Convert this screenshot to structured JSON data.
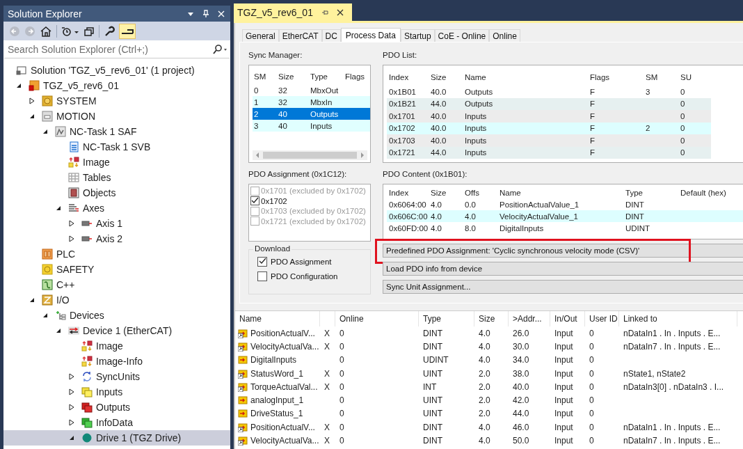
{
  "solution_explorer": {
    "title": "Solution Explorer",
    "search": {
      "placeholder": "Search Solution Explorer (Ctrl+;)"
    },
    "tree": [
      {
        "label": "Solution 'TGZ_v5_rev6_01' (1 project)",
        "kind": "solution",
        "selected": false,
        "children": [
          {
            "label": "TGZ_v5_rev6_01",
            "kind": "project",
            "expanded": true,
            "selected": false,
            "children": [
              {
                "label": "SYSTEM",
                "kind": "system",
                "expanded": false,
                "selected": false
              },
              {
                "label": "MOTION",
                "kind": "motion",
                "expanded": true,
                "selected": false,
                "children": [
                  {
                    "label": "NC-Task 1 SAF",
                    "kind": "nctask",
                    "expanded": true,
                    "selected": false,
                    "children": [
                      {
                        "label": "NC-Task 1 SVB",
                        "kind": "svb",
                        "selected": false
                      },
                      {
                        "label": "Image",
                        "kind": "image",
                        "selected": false
                      },
                      {
                        "label": "Tables",
                        "kind": "table",
                        "selected": false
                      },
                      {
                        "label": "Objects",
                        "kind": "objects",
                        "selected": false
                      },
                      {
                        "label": "Axes",
                        "kind": "axes",
                        "expanded": true,
                        "selected": false,
                        "children": [
                          {
                            "label": "Axis 1",
                            "kind": "axis",
                            "expanded": false,
                            "selected": false
                          },
                          {
                            "label": "Axis 2",
                            "kind": "axis",
                            "expanded": false,
                            "selected": false
                          }
                        ]
                      }
                    ]
                  }
                ]
              },
              {
                "label": "PLC",
                "kind": "plc",
                "selected": false
              },
              {
                "label": "SAFETY",
                "kind": "safety",
                "selected": false
              },
              {
                "label": "C++",
                "kind": "cpp",
                "selected": false
              },
              {
                "label": "I/O",
                "kind": "io",
                "expanded": true,
                "selected": false,
                "children": [
                  {
                    "label": "Devices",
                    "kind": "devices",
                    "expanded": true,
                    "selected": false,
                    "children": [
                      {
                        "label": "Device 1 (EtherCAT)",
                        "kind": "ethercat",
                        "expanded": true,
                        "selected": false,
                        "children": [
                          {
                            "label": "Image",
                            "kind": "image",
                            "selected": false
                          },
                          {
                            "label": "Image-Info",
                            "kind": "image",
                            "selected": false
                          },
                          {
                            "label": "SyncUnits",
                            "kind": "syncunits",
                            "expanded": false,
                            "selected": false
                          },
                          {
                            "label": "Inputs",
                            "kind": "inputs",
                            "expanded": false,
                            "selected": false
                          },
                          {
                            "label": "Outputs",
                            "kind": "outputs",
                            "expanded": false,
                            "selected": false
                          },
                          {
                            "label": "InfoData",
                            "kind": "infodata",
                            "expanded": false,
                            "selected": false
                          },
                          {
                            "label": "Drive 1 (TGZ Drive)",
                            "kind": "drive",
                            "expanded": true,
                            "selected": true
                          }
                        ]
                      }
                    ]
                  }
                ]
              }
            ]
          }
        ]
      }
    ]
  },
  "document_tab": {
    "title": "TGZ_v5_rev6_01"
  },
  "tabs": [
    {
      "label": "General",
      "selected": false
    },
    {
      "label": "EtherCAT",
      "selected": false
    },
    {
      "label": "DC",
      "selected": false
    },
    {
      "label": "Process Data",
      "selected": true
    },
    {
      "label": "Startup",
      "selected": false
    },
    {
      "label": "CoE - Online",
      "selected": false
    },
    {
      "label": "Online",
      "selected": false
    }
  ],
  "sync_manager": {
    "label": "Sync Manager:",
    "columns": [
      "SM",
      "Size",
      "Type",
      "Flags"
    ],
    "rows": [
      {
        "cells": [
          "0",
          "32",
          "MbxOut"
        ],
        "selected": false
      },
      {
        "cells": [
          "1",
          "32",
          "MbxIn"
        ],
        "selected": false
      },
      {
        "cells": [
          "2",
          "40",
          "Outputs"
        ],
        "selected": true
      },
      {
        "cells": [
          "3",
          "40",
          "Inputs"
        ],
        "selected": false
      }
    ]
  },
  "pdo_list": {
    "label": "PDO List:",
    "columns": [
      "Index",
      "Size",
      "Name",
      "Flags",
      "SM",
      "SU"
    ],
    "rows": [
      [
        "0x1B01",
        "40.0",
        "Outputs",
        "F",
        "3",
        "0"
      ],
      [
        "0x1B21",
        "44.0",
        "Outputs",
        "F",
        "",
        "0"
      ],
      [
        "0x1701",
        "40.0",
        "Inputs",
        "F",
        "",
        "0"
      ],
      [
        "0x1702",
        "40.0",
        "Inputs",
        "F",
        "2",
        "0"
      ],
      [
        "0x1703",
        "40.0",
        "Inputs",
        "F",
        "",
        "0"
      ],
      [
        "0x1721",
        "44.0",
        "Inputs",
        "F",
        "",
        "0"
      ]
    ]
  },
  "pdo_assignment": {
    "label": "PDO Assignment (0x1C12):",
    "items": [
      {
        "label": "0x1701 (excluded by 0x1702)",
        "checked": false,
        "disabled": true
      },
      {
        "label": "0x1702",
        "checked": true,
        "disabled": false
      },
      {
        "label": "0x1703 (excluded by 0x1702)",
        "checked": false,
        "disabled": true
      },
      {
        "label": "0x1721 (excluded by 0x1702)",
        "checked": false,
        "disabled": true
      }
    ]
  },
  "pdo_content": {
    "label": "PDO Content (0x1B01):",
    "columns": [
      "Index",
      "Size",
      "Offs",
      "Name",
      "Type",
      "Default (hex)"
    ],
    "rows": [
      [
        "0x6064:00",
        "4.0",
        "0.0",
        "PositionActualValue_1",
        "DINT",
        ""
      ],
      [
        "0x606C:00",
        "4.0",
        "4.0",
        "VelocityActualValue_1",
        "DINT",
        ""
      ],
      [
        "0x60FD:00",
        "4.0",
        "8.0",
        "DigitalInputs",
        "UDINT",
        ""
      ]
    ]
  },
  "download": {
    "label": "Download",
    "options": [
      {
        "label": "PDO Assignment",
        "checked": true
      },
      {
        "label": "PDO Configuration",
        "checked": false
      }
    ]
  },
  "buttons": [
    {
      "label": "Predefined PDO Assignment: 'Cyclic synchronous velocity mode (CSV)'",
      "highlighted": true
    },
    {
      "label": "Load PDO info from device",
      "highlighted": false
    },
    {
      "label": "Sync Unit Assignment...",
      "highlighted": false
    }
  ],
  "variables": {
    "columns": [
      "Name",
      "Online",
      "Type",
      "Size",
      ">Addr...",
      "In/Out",
      "User ID",
      "Linked to"
    ],
    "rows": [
      {
        "name": "PositionActualV...",
        "linked": true,
        "column_2": "X",
        "online": "0",
        "type": "DINT",
        "size": "4.0",
        "addr": "26.0",
        "in_out": "Input",
        "user_id": "0",
        "linked_to": "nDataIn1 . In . Inputs . E..."
      },
      {
        "name": "VelocityActualVa...",
        "linked": true,
        "column_2": "X",
        "online": "0",
        "type": "DINT",
        "size": "4.0",
        "addr": "30.0",
        "in_out": "Input",
        "user_id": "0",
        "linked_to": "nDataIn7 . In . Inputs . E..."
      },
      {
        "name": "DigitalInputs",
        "linked": false,
        "online": "0",
        "type": "UDINT",
        "size": "4.0",
        "addr": "34.0",
        "in_out": "Input",
        "user_id": "0"
      },
      {
        "name": "StatusWord_1",
        "linked": true,
        "column_2": "X",
        "online": "0",
        "type": "UINT",
        "size": "2.0",
        "addr": "38.0",
        "in_out": "Input",
        "user_id": "0",
        "linked_to": "nState1, nState2"
      },
      {
        "name": "TorqueActualVal...",
        "linked": true,
        "column_2": "X",
        "online": "0",
        "type": "INT",
        "size": "2.0",
        "addr": "40.0",
        "in_out": "Input",
        "user_id": "0",
        "linked_to": "nDataIn3[0] . nDataIn3 . I..."
      },
      {
        "name": "analogInput_1",
        "linked": false,
        "online": "0",
        "type": "UINT",
        "size": "2.0",
        "addr": "42.0",
        "in_out": "Input",
        "user_id": "0"
      },
      {
        "name": "DriveStatus_1",
        "linked": false,
        "online": "0",
        "type": "UINT",
        "size": "2.0",
        "addr": "44.0",
        "in_out": "Input",
        "user_id": "0"
      },
      {
        "name": "PositionActualV...",
        "linked": true,
        "column_2": "X",
        "online": "0",
        "type": "DINT",
        "size": "4.0",
        "addr": "46.0",
        "in_out": "Input",
        "user_id": "0",
        "linked_to": "nDataIn1 . In . Inputs . E..."
      },
      {
        "name": "VelocityActualVa...",
        "linked": true,
        "column_2": "X",
        "online": "0",
        "type": "DINT",
        "size": "4.0",
        "addr": "50.0",
        "in_out": "Input",
        "user_id": "0",
        "linked_to": "nDataIn7 . In . Inputs . E..."
      }
    ]
  }
}
